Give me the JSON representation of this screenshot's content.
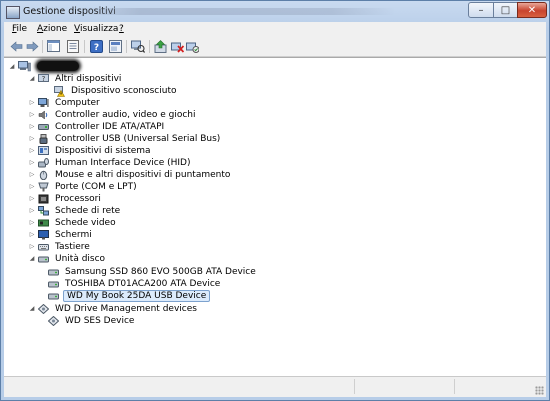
{
  "window": {
    "title": "Gestione dispositivi"
  },
  "titlebar_buttons": {
    "minimize": "–",
    "maximize": "□",
    "close": "✕"
  },
  "menu": [
    {
      "label": "File",
      "underline": "F"
    },
    {
      "label": "Azione",
      "underline": "A"
    },
    {
      "label": "Visualizza",
      "underline": "V"
    },
    {
      "label": "?",
      "underline": "?"
    }
  ],
  "toolbar": [
    {
      "name": "back-arrow-icon"
    },
    {
      "name": "forward-arrow-icon"
    },
    {
      "name": "show-hide-console-tree-icon"
    },
    {
      "name": "properties-icon"
    },
    {
      "name": "help-icon"
    },
    {
      "name": "help-topics-icon"
    },
    {
      "name": "scan-hardware-icon"
    },
    {
      "name": "update-driver-icon"
    },
    {
      "name": "uninstall-device-icon"
    },
    {
      "name": "enable-device-icon"
    }
  ],
  "tree": {
    "root_label": "",
    "nodes": [
      {
        "label": "Altri dispositivi",
        "icon": "unknown-device-icon",
        "level": 1,
        "expanded": true
      },
      {
        "label": "Dispositivo sconosciuto",
        "icon": "warning-device-icon",
        "level": 2
      },
      {
        "label": "Computer",
        "icon": "computer-icon",
        "level": 1,
        "expanded": false
      },
      {
        "label": "Controller audio, video e giochi",
        "icon": "audio-icon",
        "level": 1,
        "expanded": false
      },
      {
        "label": "Controller IDE ATA/ATAPI",
        "icon": "ide-controller-icon",
        "level": 1,
        "expanded": false
      },
      {
        "label": "Controller USB (Universal Serial Bus)",
        "icon": "usb-icon",
        "level": 1,
        "expanded": false
      },
      {
        "label": "Dispositivi di sistema",
        "icon": "system-devices-icon",
        "level": 1,
        "expanded": false
      },
      {
        "label": "Human Interface Device (HID)",
        "icon": "hid-icon",
        "level": 1,
        "expanded": false
      },
      {
        "label": "Mouse e altri dispositivi di puntamento",
        "icon": "mouse-icon",
        "level": 1,
        "expanded": false
      },
      {
        "label": "Porte (COM e LPT)",
        "icon": "port-icon",
        "level": 1,
        "expanded": false
      },
      {
        "label": "Processori",
        "icon": "processor-icon",
        "level": 1,
        "expanded": false
      },
      {
        "label": "Schede di rete",
        "icon": "network-adapter-icon",
        "level": 1,
        "expanded": false
      },
      {
        "label": "Schede video",
        "icon": "display-adapter-icon",
        "level": 1,
        "expanded": false
      },
      {
        "label": "Schermi",
        "icon": "monitor-icon",
        "level": 1,
        "expanded": false
      },
      {
        "label": "Tastiere",
        "icon": "keyboard-icon",
        "level": 1,
        "expanded": false
      },
      {
        "label": "Unità disco",
        "icon": "disk-drive-icon",
        "level": 1,
        "expanded": true
      },
      {
        "label": "Samsung SSD 860 EVO 500GB ATA Device",
        "icon": "disk-drive-icon",
        "level": 2
      },
      {
        "label": "TOSHIBA DT01ACA200 ATA Device",
        "icon": "disk-drive-icon",
        "level": 2
      },
      {
        "label": "WD My Book 25DA USB Device",
        "icon": "disk-drive-icon",
        "level": 2,
        "selected": true
      },
      {
        "label": "WD Drive Management devices",
        "icon": "wd-management-icon",
        "level": 1,
        "expanded": true
      },
      {
        "label": "WD SES Device",
        "icon": "wd-management-icon",
        "level": 2
      }
    ]
  }
}
